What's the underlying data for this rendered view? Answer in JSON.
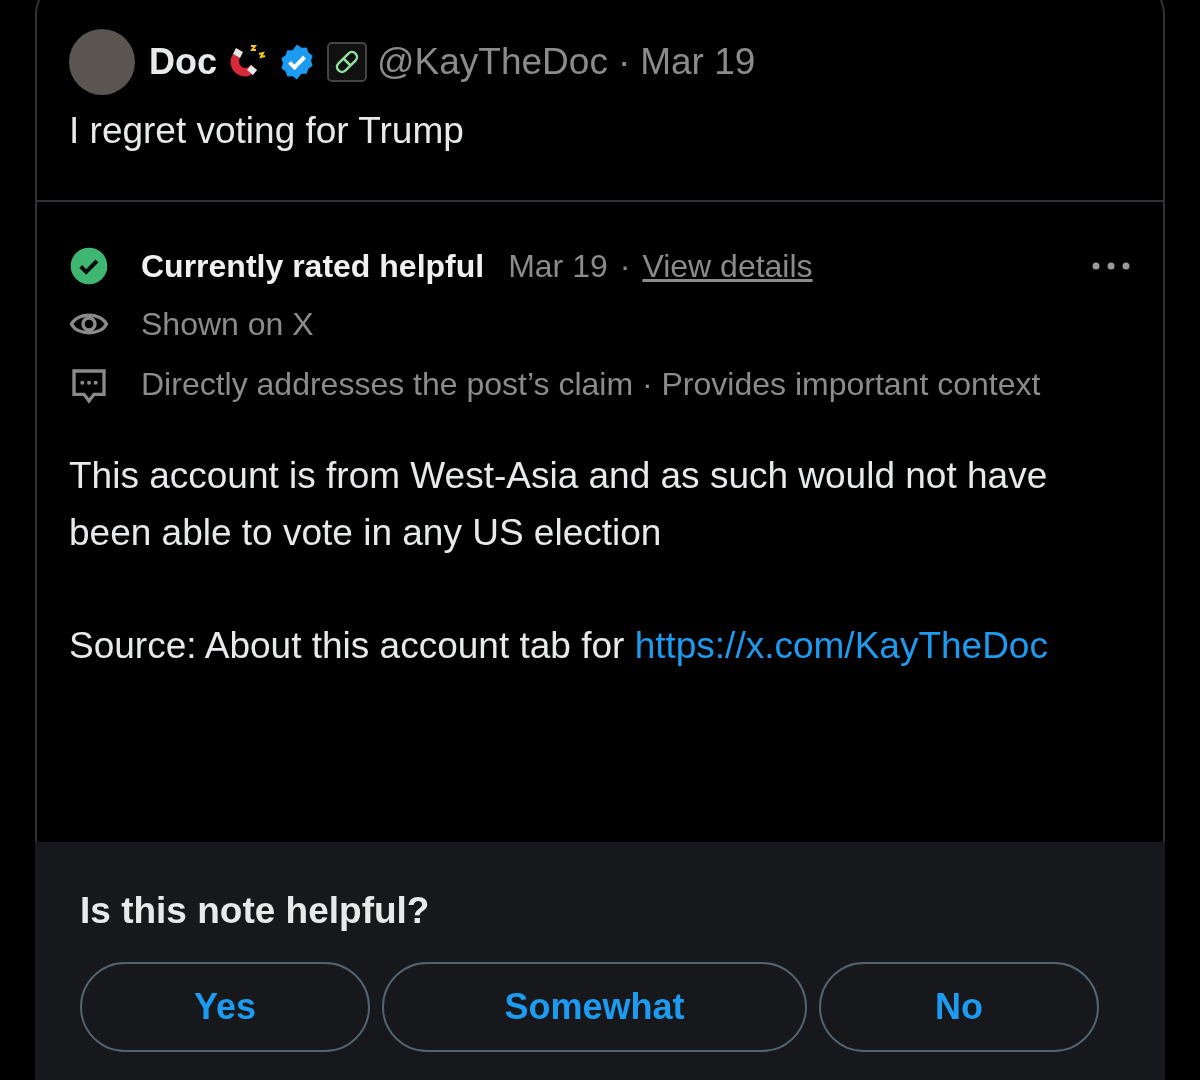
{
  "post": {
    "display_name": "Doc",
    "verified": true,
    "handle": "@KayTheDoc",
    "separator": "·",
    "date": "Mar 19",
    "text": "I regret voting for Trump"
  },
  "note": {
    "status": "Currently rated helpful",
    "date": "Mar 19",
    "separator": "·",
    "details_link": "View details",
    "shown_on": "Shown on X",
    "reasons": "Directly addresses the post’s claim · Provides important context",
    "body": "This account is from West-Asia and as such would not have been able to vote in any US election",
    "source": "Source: About this account tab for",
    "link": "https://x.com/KayTheDoc"
  },
  "rating": {
    "question": "Is this note helpful?",
    "options": [
      {
        "label": "Yes"
      },
      {
        "label": "Somewhat"
      },
      {
        "label": "No"
      }
    ]
  }
}
